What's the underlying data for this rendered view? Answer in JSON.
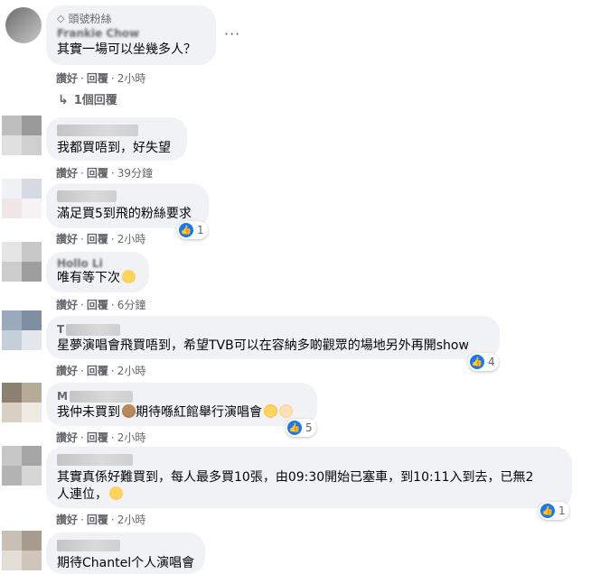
{
  "common": {
    "like": "讚好",
    "reply": "回覆",
    "separator": "·"
  },
  "comments": [
    {
      "badge": "頭號粉絲",
      "name": "Frankie Chow",
      "text": "其實一場可以坐幾多人？",
      "time": "2小時",
      "replies": "1個回覆"
    },
    {
      "name": "",
      "text": "我都買唔到，好失望",
      "time": "39分鐘"
    },
    {
      "name": "",
      "text": "滿足買5到飛的粉絲要求",
      "time": "2小時",
      "reactions": "1"
    },
    {
      "name": "Hollo Li",
      "text": "唯有等下次",
      "time": "6分鐘"
    },
    {
      "name": "T",
      "text": "星夢演唱會飛買唔到，希望TVB可以在容納多啲觀眾的場地另外再開show",
      "time": "2小時",
      "reactions": "4"
    },
    {
      "name": "M",
      "text": "我仲未買到",
      "text2": "期待喺紅館舉行演唱會",
      "time": "2小時",
      "reactions": "5"
    },
    {
      "name": "",
      "text": "其實真係好難買到，每人最多買10張，由09:30開始已塞車，到10:11入到去，已無2",
      "text_line2": "人連位，",
      "time": "2小時",
      "reactions": "1"
    },
    {
      "name": "",
      "text": "期待Chantel个人演唱會"
    }
  ],
  "colors": {
    "bubble": "#f0f2f5",
    "meta": "#65676b",
    "like_blue": "#1877f2"
  },
  "icons": [
    "diamond-icon",
    "more-dots-icon",
    "reply-arrow-icon",
    "like-icon"
  ]
}
